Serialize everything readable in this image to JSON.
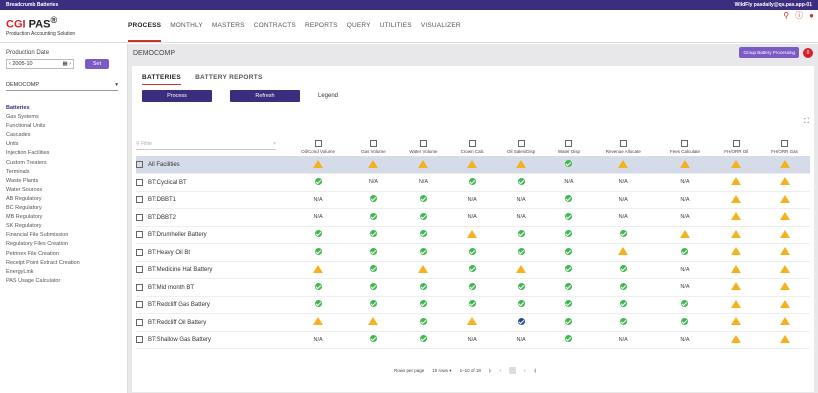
{
  "topbar": {
    "left": "Breadcrumb   Batteries",
    "right": "WildFly pasdaily@qs.pas.app-01"
  },
  "logo": {
    "brand": "CGI",
    "product": "PAS",
    "reg": "®",
    "sub": "Production Accounting Solution"
  },
  "nav": [
    "PROCESS",
    "MONTHLY",
    "MASTERS",
    "CONTRACTS",
    "REPORTS",
    "QUERY",
    "UTILITIES",
    "VISUALIZER"
  ],
  "sidebar": {
    "date_label": "Production Date",
    "date_value": "2005-10",
    "set_label": "Set",
    "company": "DEMOCOMP",
    "menu": [
      "Batteries",
      "Gas Systems",
      "Functional Units",
      "Cascades",
      "Units",
      "Injection Facilities",
      "Custom Treaters",
      "Terminals",
      "Waste Plants",
      "Water Sources",
      "AB Regulatory",
      "BC Regulatory",
      "MB Regulatory",
      "SK Regulatory",
      "Financial File Submission",
      "Regulatory Files Creation",
      "Petrinex File Creation",
      "Receipt Point Extract Creation",
      "EnergyLink",
      "PAS Usage Calculator"
    ]
  },
  "main": {
    "company": "DEMOCOMP",
    "group_btn": "Group Battery Processing",
    "badge": "0",
    "tabs": [
      "BATTERIES",
      "BATTERY REPORTS"
    ],
    "process": "Process",
    "refresh": "Refresh",
    "legend": "Legend",
    "filter_placeholder": "Filter",
    "columns": [
      "Oil/Cond Volume",
      "Gas Volume",
      "Water Volume",
      "Crown Calc",
      "Oil Sales/Disp",
      "Water Disp",
      "Revenue Allocate",
      "Fees Calculate",
      "FH/ORR Oil",
      "FH/ORR Gas"
    ],
    "rows": [
      {
        "name": "All Facilities",
        "hl": true,
        "s": [
          "W",
          "W",
          "W",
          "W",
          "W",
          "O",
          "W",
          "W",
          "W",
          "W"
        ]
      },
      {
        "name": "BT:Cyclical BT",
        "s": [
          "O",
          "N/A",
          "N/A",
          "O",
          "O",
          "N/A",
          "N/A",
          "N/A",
          "W",
          "W"
        ]
      },
      {
        "name": "BT:DBBT1",
        "s": [
          "N/A",
          "O",
          "O",
          "N/A",
          "N/A",
          "O",
          "N/A",
          "N/A",
          "W",
          "W"
        ]
      },
      {
        "name": "BT:DBBT2",
        "s": [
          "N/A",
          "O",
          "O",
          "N/A",
          "N/A",
          "O",
          "N/A",
          "N/A",
          "W",
          "W"
        ]
      },
      {
        "name": "BT:Drumheller Battery",
        "s": [
          "O",
          "O",
          "O",
          "W",
          "O",
          "O",
          "O",
          "W",
          "W",
          "W"
        ]
      },
      {
        "name": "BT:Heavy Oil Bt",
        "s": [
          "O",
          "O",
          "O",
          "O",
          "O",
          "O",
          "W",
          "O",
          "W",
          "W"
        ]
      },
      {
        "name": "BT:Medicine Hat Battery",
        "s": [
          "W",
          "O",
          "W",
          "O",
          "W",
          "O",
          "O",
          "N/A",
          "W",
          "W"
        ]
      },
      {
        "name": "BT:Mid month BT",
        "s": [
          "O",
          "O",
          "O",
          "O",
          "O",
          "O",
          "O",
          "N/A",
          "W",
          "W"
        ]
      },
      {
        "name": "BT:Redcliff Gas Battery",
        "s": [
          "O",
          "O",
          "O",
          "O",
          "O",
          "O",
          "O",
          "O",
          "W",
          "W"
        ]
      },
      {
        "name": "BT:Redcliff Oil Battery",
        "s": [
          "W",
          "W",
          "O",
          "W",
          "B",
          "O",
          "O",
          "O",
          "W",
          "W"
        ]
      },
      {
        "name": "BT:Shallow Gas Battery",
        "s": [
          "N/A",
          "O",
          "O",
          "N/A",
          "N/A",
          "O",
          "N/A",
          "N/A",
          "W",
          "W"
        ]
      }
    ],
    "pager": {
      "rows_label": "Rows per page",
      "rows_value": "10 rows",
      "range": "1–10 of 18",
      "first": "|‹",
      "prev": "‹",
      "next": "›",
      "last": "›|"
    }
  }
}
